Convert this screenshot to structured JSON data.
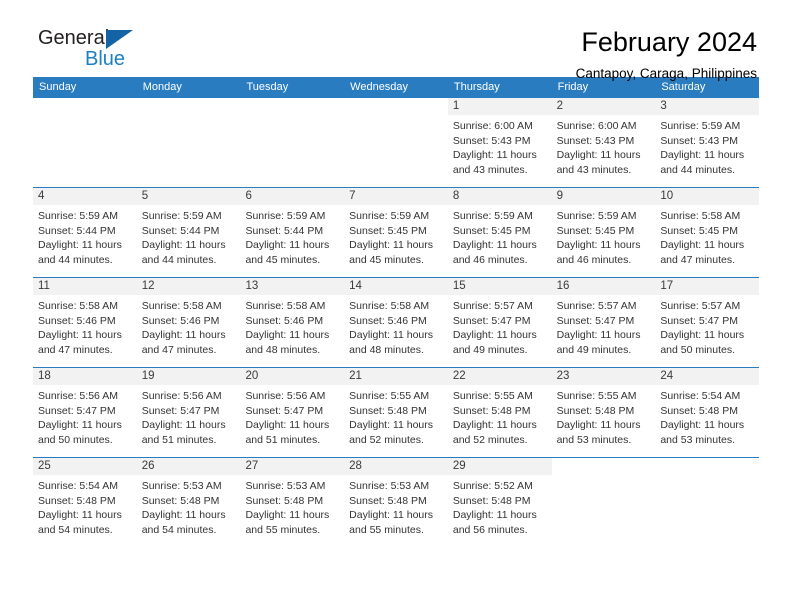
{
  "brand": {
    "line1": "General",
    "line2": "Blue",
    "triangle_icon": "blue-triangle-icon",
    "colors": {
      "text": "#231f20",
      "accent": "#1c7fc4",
      "triangle": "#1464a5"
    }
  },
  "header": {
    "month_title": "February 2024",
    "location": "Cantapoy, Caraga, Philippines"
  },
  "theme": {
    "header_blue": "#2a7cc0",
    "daynum_band": "#f2f2f2",
    "cell_text": "#333333"
  },
  "calendar": {
    "weekdays": [
      "Sunday",
      "Monday",
      "Tuesday",
      "Wednesday",
      "Thursday",
      "Friday",
      "Saturday"
    ],
    "weeks": [
      [
        {
          "day": "",
          "lines": []
        },
        {
          "day": "",
          "lines": []
        },
        {
          "day": "",
          "lines": []
        },
        {
          "day": "",
          "lines": []
        },
        {
          "day": "1",
          "lines": [
            "Sunrise: 6:00 AM",
            "Sunset: 5:43 PM",
            "Daylight: 11 hours",
            "and 43 minutes."
          ]
        },
        {
          "day": "2",
          "lines": [
            "Sunrise: 6:00 AM",
            "Sunset: 5:43 PM",
            "Daylight: 11 hours",
            "and 43 minutes."
          ]
        },
        {
          "day": "3",
          "lines": [
            "Sunrise: 5:59 AM",
            "Sunset: 5:43 PM",
            "Daylight: 11 hours",
            "and 44 minutes."
          ]
        }
      ],
      [
        {
          "day": "4",
          "lines": [
            "Sunrise: 5:59 AM",
            "Sunset: 5:44 PM",
            "Daylight: 11 hours",
            "and 44 minutes."
          ]
        },
        {
          "day": "5",
          "lines": [
            "Sunrise: 5:59 AM",
            "Sunset: 5:44 PM",
            "Daylight: 11 hours",
            "and 44 minutes."
          ]
        },
        {
          "day": "6",
          "lines": [
            "Sunrise: 5:59 AM",
            "Sunset: 5:44 PM",
            "Daylight: 11 hours",
            "and 45 minutes."
          ]
        },
        {
          "day": "7",
          "lines": [
            "Sunrise: 5:59 AM",
            "Sunset: 5:45 PM",
            "Daylight: 11 hours",
            "and 45 minutes."
          ]
        },
        {
          "day": "8",
          "lines": [
            "Sunrise: 5:59 AM",
            "Sunset: 5:45 PM",
            "Daylight: 11 hours",
            "and 46 minutes."
          ]
        },
        {
          "day": "9",
          "lines": [
            "Sunrise: 5:59 AM",
            "Sunset: 5:45 PM",
            "Daylight: 11 hours",
            "and 46 minutes."
          ]
        },
        {
          "day": "10",
          "lines": [
            "Sunrise: 5:58 AM",
            "Sunset: 5:45 PM",
            "Daylight: 11 hours",
            "and 47 minutes."
          ]
        }
      ],
      [
        {
          "day": "11",
          "lines": [
            "Sunrise: 5:58 AM",
            "Sunset: 5:46 PM",
            "Daylight: 11 hours",
            "and 47 minutes."
          ]
        },
        {
          "day": "12",
          "lines": [
            "Sunrise: 5:58 AM",
            "Sunset: 5:46 PM",
            "Daylight: 11 hours",
            "and 47 minutes."
          ]
        },
        {
          "day": "13",
          "lines": [
            "Sunrise: 5:58 AM",
            "Sunset: 5:46 PM",
            "Daylight: 11 hours",
            "and 48 minutes."
          ]
        },
        {
          "day": "14",
          "lines": [
            "Sunrise: 5:58 AM",
            "Sunset: 5:46 PM",
            "Daylight: 11 hours",
            "and 48 minutes."
          ]
        },
        {
          "day": "15",
          "lines": [
            "Sunrise: 5:57 AM",
            "Sunset: 5:47 PM",
            "Daylight: 11 hours",
            "and 49 minutes."
          ]
        },
        {
          "day": "16",
          "lines": [
            "Sunrise: 5:57 AM",
            "Sunset: 5:47 PM",
            "Daylight: 11 hours",
            "and 49 minutes."
          ]
        },
        {
          "day": "17",
          "lines": [
            "Sunrise: 5:57 AM",
            "Sunset: 5:47 PM",
            "Daylight: 11 hours",
            "and 50 minutes."
          ]
        }
      ],
      [
        {
          "day": "18",
          "lines": [
            "Sunrise: 5:56 AM",
            "Sunset: 5:47 PM",
            "Daylight: 11 hours",
            "and 50 minutes."
          ]
        },
        {
          "day": "19",
          "lines": [
            "Sunrise: 5:56 AM",
            "Sunset: 5:47 PM",
            "Daylight: 11 hours",
            "and 51 minutes."
          ]
        },
        {
          "day": "20",
          "lines": [
            "Sunrise: 5:56 AM",
            "Sunset: 5:47 PM",
            "Daylight: 11 hours",
            "and 51 minutes."
          ]
        },
        {
          "day": "21",
          "lines": [
            "Sunrise: 5:55 AM",
            "Sunset: 5:48 PM",
            "Daylight: 11 hours",
            "and 52 minutes."
          ]
        },
        {
          "day": "22",
          "lines": [
            "Sunrise: 5:55 AM",
            "Sunset: 5:48 PM",
            "Daylight: 11 hours",
            "and 52 minutes."
          ]
        },
        {
          "day": "23",
          "lines": [
            "Sunrise: 5:55 AM",
            "Sunset: 5:48 PM",
            "Daylight: 11 hours",
            "and 53 minutes."
          ]
        },
        {
          "day": "24",
          "lines": [
            "Sunrise: 5:54 AM",
            "Sunset: 5:48 PM",
            "Daylight: 11 hours",
            "and 53 minutes."
          ]
        }
      ],
      [
        {
          "day": "25",
          "lines": [
            "Sunrise: 5:54 AM",
            "Sunset: 5:48 PM",
            "Daylight: 11 hours",
            "and 54 minutes."
          ]
        },
        {
          "day": "26",
          "lines": [
            "Sunrise: 5:53 AM",
            "Sunset: 5:48 PM",
            "Daylight: 11 hours",
            "and 54 minutes."
          ]
        },
        {
          "day": "27",
          "lines": [
            "Sunrise: 5:53 AM",
            "Sunset: 5:48 PM",
            "Daylight: 11 hours",
            "and 55 minutes."
          ]
        },
        {
          "day": "28",
          "lines": [
            "Sunrise: 5:53 AM",
            "Sunset: 5:48 PM",
            "Daylight: 11 hours",
            "and 55 minutes."
          ]
        },
        {
          "day": "29",
          "lines": [
            "Sunrise: 5:52 AM",
            "Sunset: 5:48 PM",
            "Daylight: 11 hours",
            "and 56 minutes."
          ]
        },
        {
          "day": "",
          "lines": []
        },
        {
          "day": "",
          "lines": []
        }
      ]
    ]
  }
}
